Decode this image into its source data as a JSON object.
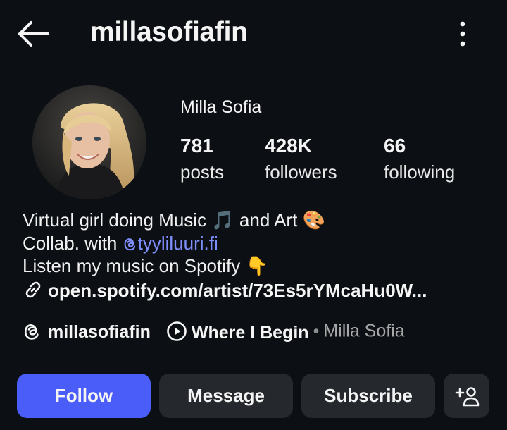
{
  "header": {
    "username": "millasofiafin",
    "back_icon": "arrow-left-icon",
    "more_icon": "vertical-ellipsis-icon"
  },
  "profile": {
    "display_name": "Milla Sofia",
    "stats": {
      "posts": {
        "value": "781",
        "label": "posts"
      },
      "followers": {
        "value": "428K",
        "label": "followers"
      },
      "following": {
        "value": "66",
        "label": "following"
      }
    }
  },
  "bio": {
    "line1_text": "Virtual girl doing Music ",
    "line1_emoji1": "🎵",
    "line1_mid": " and Art ",
    "line1_emoji2": "🎨",
    "line2_prefix": "Collab. with ",
    "line2_mention": "tyyliluuri.fi",
    "line3_text": "Listen my music on Spotify ",
    "line3_emoji": "👇",
    "link": "open.spotify.com/artist/73Es5rYMcaHu0W..."
  },
  "meta": {
    "threads_handle": "millasofiafin",
    "song_title": "Where I Begin",
    "separator": "•",
    "song_artist": "Milla Sofia"
  },
  "actions": {
    "follow": "Follow",
    "message": "Message",
    "subscribe": "Subscribe",
    "add_user_icon": "add-user-icon"
  },
  "colors": {
    "background": "#0c1014",
    "follow_button": "#4a5df9",
    "secondary_button": "#25292e",
    "mention": "#7f8fff"
  }
}
